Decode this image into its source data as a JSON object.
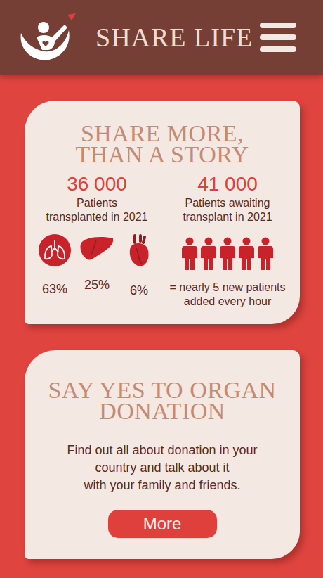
{
  "header": {
    "title": "SHARE LIFE"
  },
  "stats_card": {
    "title_lines": [
      "SHARE MORE,",
      "THAN A STORY"
    ],
    "transplanted": {
      "count": "36 000",
      "label_lines": [
        "Patients",
        "transplanted in 2021"
      ],
      "organs": [
        {
          "kind": "lungs",
          "share": "63%"
        },
        {
          "kind": "liver",
          "share": "25%"
        },
        {
          "kind": "heart",
          "share": "6%"
        }
      ]
    },
    "awaiting": {
      "count": "41 000",
      "label_lines": [
        "Patients awaiting",
        "transplant in 2021"
      ],
      "note_lines": [
        "= nearly 5 new patients",
        "added every hour"
      ]
    }
  },
  "cta_card": {
    "title_lines": [
      "SAY YES TO ORGAN",
      "DONATION"
    ],
    "text_lines": [
      "Find out all about donation in your",
      "country and talk about it",
      "with your family and friends."
    ],
    "button": "More"
  }
}
